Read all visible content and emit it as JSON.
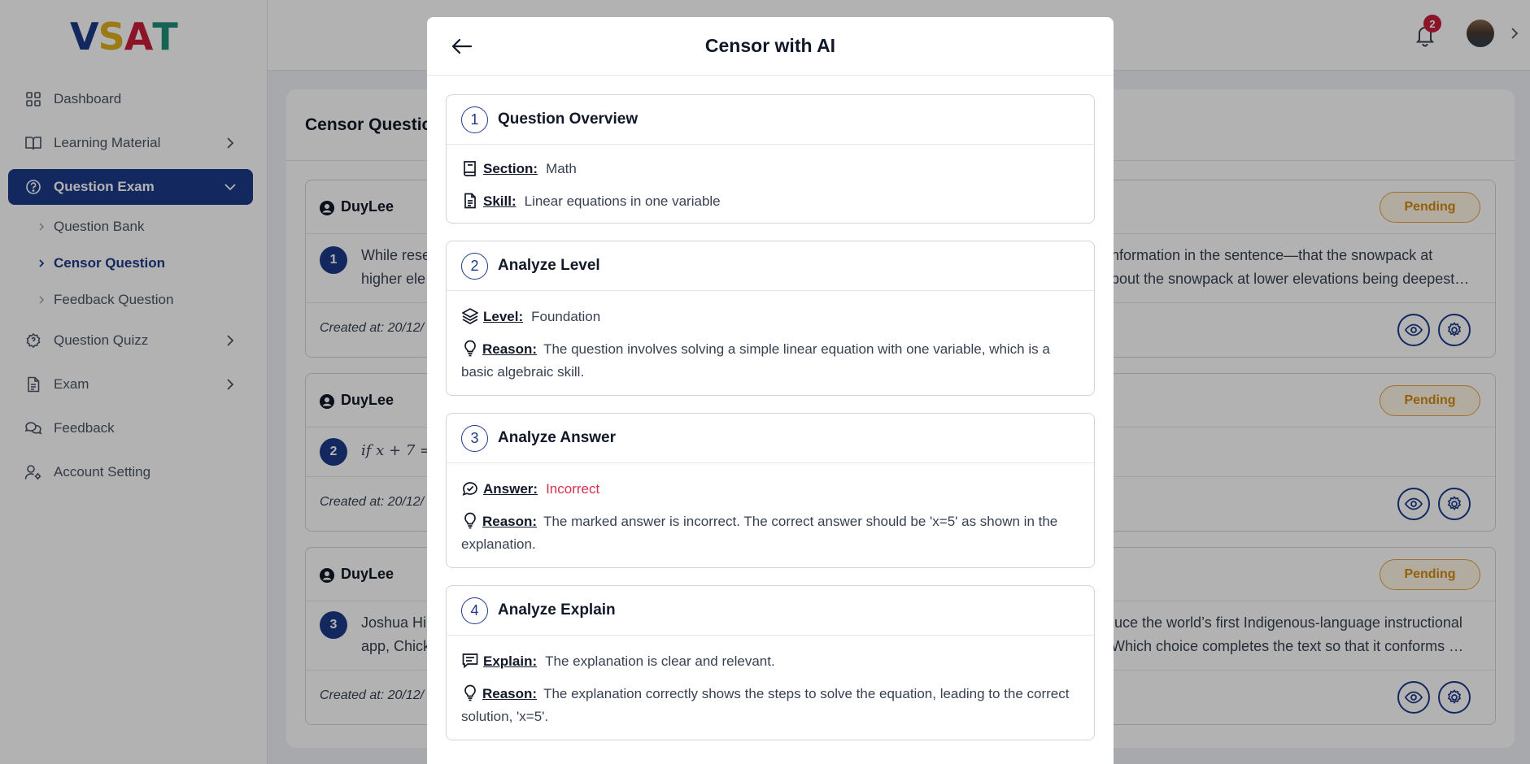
{
  "brand": {
    "letters": [
      "V",
      "S",
      "A",
      "T"
    ],
    "colors": [
      "#1e3a8a",
      "#e0b020",
      "#c81e3a",
      "#1e8f7a"
    ]
  },
  "sidebar": {
    "items": [
      {
        "label": "Dashboard",
        "icon": "grid-icon"
      },
      {
        "label": "Learning Material",
        "icon": "book-icon"
      },
      {
        "label": "Question Exam",
        "icon": "question-circle-icon",
        "active": true
      },
      {
        "label": "Question Quizz",
        "icon": "quiz-icon"
      },
      {
        "label": "Exam",
        "icon": "document-icon"
      },
      {
        "label": "Feedback",
        "icon": "chat-icon"
      },
      {
        "label": "Account Setting",
        "icon": "user-gear-icon"
      }
    ],
    "subitems": [
      {
        "label": "Question Bank"
      },
      {
        "label": "Censor Question",
        "active": true
      },
      {
        "label": "Feedback Question"
      }
    ]
  },
  "header": {
    "notification_count": "2"
  },
  "panel": {
    "title": "Censor Questic",
    "cards": [
      {
        "author": "DuyLee",
        "status": "Pending",
        "number": "1",
        "line1": "While rese",
        "line2": "higher ele",
        "right1": "nformation in the sentence—that the snowpack at",
        "right2": "bout the snowpack at lower elevations being deepest…",
        "created": "Created at: 20/12/"
      },
      {
        "author": "DuyLee",
        "status": "Pending",
        "number": "2",
        "line1": "if x + 7 =",
        "line2": "",
        "right1": "",
        "right2": "",
        "created": "Created at: 20/12/"
      },
      {
        "author": "DuyLee",
        "status": "Pending",
        "number": "3",
        "line1": "Joshua Hi",
        "line2": "app, Chick",
        "right1": "luce the world’s first Indigenous-language instructional",
        "right2": "Which choice completes the text so that it conforms …",
        "created": "Created at: 20/12/"
      }
    ]
  },
  "modal": {
    "title": "Censor with AI",
    "steps": [
      {
        "num": "1",
        "title": "Question Overview",
        "section_label": "Section:",
        "section_value": "Math",
        "skill_label": "Skill:",
        "skill_value": "Linear equations in one variable"
      },
      {
        "num": "2",
        "title": "Analyze Level",
        "level_label": "Level:",
        "level_value": "Foundation",
        "reason_label": "Reason:",
        "reason_value": "The question involves solving a simple linear equation with one variable, which is a basic algebraic skill."
      },
      {
        "num": "3",
        "title": "Analyze Answer",
        "answer_label": "Answer:",
        "answer_value": "Incorrect",
        "reason_label": "Reason:",
        "reason_value": "The marked answer is incorrect. The correct answer should be 'x=5' as shown in the explanation."
      },
      {
        "num": "4",
        "title": "Analyze Explain",
        "explain_label": "Explain:",
        "explain_value": "The explanation is clear and relevant.",
        "reason_label": "Reason:",
        "reason_value": "The explanation correctly shows the steps to solve the equation, leading to the correct solution, 'x=5'."
      }
    ]
  }
}
